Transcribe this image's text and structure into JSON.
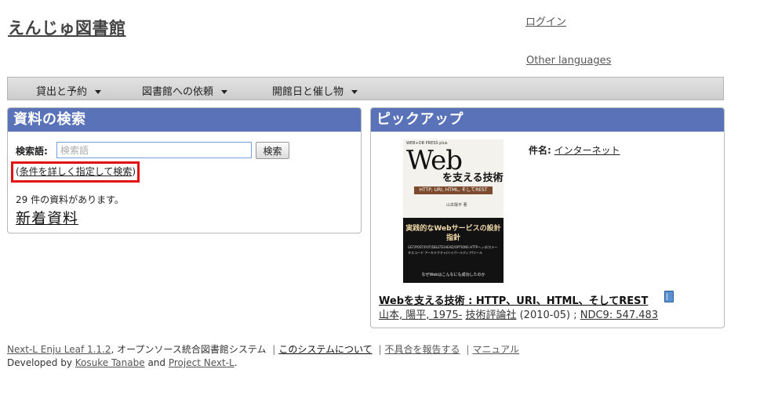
{
  "header": {
    "site_title": "えんじゅ図書館",
    "login": "ログイン",
    "other_languages": "Other languages"
  },
  "nav": {
    "items": [
      {
        "label": "貸出と予約"
      },
      {
        "label": "図書館への依頼"
      },
      {
        "label": "開館日と催し物"
      }
    ]
  },
  "search_panel": {
    "title": "資料の検索",
    "label": "検索語:",
    "placeholder": "検索語",
    "button": "検索",
    "advanced_link": "条件を詳しく指定して検索",
    "count_text": "29 件の資料があります。",
    "new_items": "新着資料",
    "highlight_color": "#e01010"
  },
  "pickup_panel": {
    "title": "ピックアップ",
    "subject_label": "件名:",
    "subject_value": "インターネット",
    "book": {
      "title": "Webを支える技術 : HTTP、URI、HTML、そしてREST",
      "author": "山本, 陽平, 1975-",
      "publisher": "技術評論社",
      "date": "(2010-05) ;",
      "ndc": "NDC9: 547.483",
      "cover": {
        "series": "WEB+DB PRESS plus",
        "big": "Web",
        "sub": "を支える技術",
        "band": "HTTP, URI, HTML, そしてREST",
        "author": "山本陽平 著",
        "bottom_title": "実践的なWebサービスの設計指針",
        "lines": "GET/POST/PUT/DELETE/HEAD/OPTIONS HTTPヘッダ/ステータスコード アーキテクチャ/ハイパーメディア/ツール",
        "foot": "なぜWebはこんなにも成功したのか"
      }
    }
  },
  "footer": {
    "product": "Next-L Enju Leaf 1.1.2",
    "system_text": ", オープンソース統合図書館システム",
    "about": "このシステムについて",
    "report": "不具合を報告する",
    "manual": "マニュアル",
    "developed_by": "Developed by",
    "developer": "Kosuke Tanabe",
    "and": "and",
    "project": "Project Next-L",
    "period": "."
  },
  "colors": {
    "panel_header": "#5a73b8",
    "navbar": "#d6d6d6"
  }
}
